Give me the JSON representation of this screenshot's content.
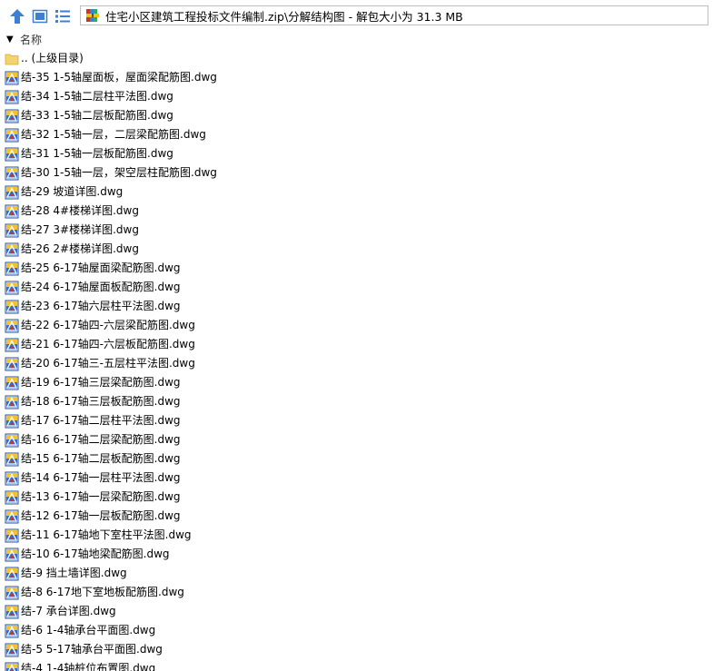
{
  "toolbar": {
    "up_icon": "up-arrow-icon",
    "view_icon": "large-icon-view-icon",
    "list_icon": "list-view-icon"
  },
  "address": {
    "icon": "zip-archive-icon",
    "text": "住宅小区建筑工程投标文件编制.zip\\分解结构图 - 解包大小为 31.3 MB"
  },
  "header": {
    "sort_indicator": "▼",
    "name_column": "名称"
  },
  "items": [
    {
      "icon": "folder-up-icon",
      "label": ".. (上级目录)"
    },
    {
      "icon": "dwg-file-icon",
      "label": "结-35 1-5轴屋面板，屋面梁配筋图.dwg"
    },
    {
      "icon": "dwg-file-icon",
      "label": "结-34 1-5轴二层柱平法图.dwg"
    },
    {
      "icon": "dwg-file-icon",
      "label": "结-33 1-5轴二层板配筋图.dwg"
    },
    {
      "icon": "dwg-file-icon",
      "label": "结-32 1-5轴一层，二层梁配筋图.dwg"
    },
    {
      "icon": "dwg-file-icon",
      "label": "结-31 1-5轴一层板配筋图.dwg"
    },
    {
      "icon": "dwg-file-icon",
      "label": "结-30 1-5轴一层，架空层柱配筋图.dwg"
    },
    {
      "icon": "dwg-file-icon",
      "label": "结-29 坡道详图.dwg"
    },
    {
      "icon": "dwg-file-icon",
      "label": "结-28 4#楼梯详图.dwg"
    },
    {
      "icon": "dwg-file-icon",
      "label": "结-27 3#楼梯详图.dwg"
    },
    {
      "icon": "dwg-file-icon",
      "label": "结-26 2#楼梯详图.dwg"
    },
    {
      "icon": "dwg-file-icon",
      "label": "结-25 6-17轴屋面梁配筋图.dwg"
    },
    {
      "icon": "dwg-file-icon",
      "label": "结-24 6-17轴屋面板配筋图.dwg"
    },
    {
      "icon": "dwg-file-icon",
      "label": "结-23 6-17轴六层柱平法图.dwg"
    },
    {
      "icon": "dwg-file-icon",
      "label": "结-22 6-17轴四-六层梁配筋图.dwg"
    },
    {
      "icon": "dwg-file-icon",
      "label": "结-21 6-17轴四-六层板配筋图.dwg"
    },
    {
      "icon": "dwg-file-icon",
      "label": "结-20 6-17轴三-五层柱平法图.dwg"
    },
    {
      "icon": "dwg-file-icon",
      "label": "结-19 6-17轴三层梁配筋图.dwg"
    },
    {
      "icon": "dwg-file-icon",
      "label": "结-18 6-17轴三层板配筋图.dwg"
    },
    {
      "icon": "dwg-file-icon",
      "label": "结-17 6-17轴二层柱平法图.dwg"
    },
    {
      "icon": "dwg-file-icon",
      "label": "结-16 6-17轴二层梁配筋图.dwg"
    },
    {
      "icon": "dwg-file-icon",
      "label": "结-15 6-17轴二层板配筋图.dwg"
    },
    {
      "icon": "dwg-file-icon",
      "label": "结-14 6-17轴一层柱平法图.dwg"
    },
    {
      "icon": "dwg-file-icon",
      "label": "结-13 6-17轴一层梁配筋图.dwg"
    },
    {
      "icon": "dwg-file-icon",
      "label": "结-12 6-17轴一层板配筋图.dwg"
    },
    {
      "icon": "dwg-file-icon",
      "label": "结-11 6-17轴地下室柱平法图.dwg"
    },
    {
      "icon": "dwg-file-icon",
      "label": "结-10 6-17轴地梁配筋图.dwg"
    },
    {
      "icon": "dwg-file-icon",
      "label": "结-9 挡土墙详图.dwg"
    },
    {
      "icon": "dwg-file-icon",
      "label": "结-8 6-17地下室地板配筋图.dwg"
    },
    {
      "icon": "dwg-file-icon",
      "label": "结-7 承台详图.dwg"
    },
    {
      "icon": "dwg-file-icon",
      "label": "结-6 1-4轴承台平面图.dwg"
    },
    {
      "icon": "dwg-file-icon",
      "label": "结-5 5-17轴承台平面图.dwg"
    },
    {
      "icon": "dwg-file-icon",
      "label": "结-4 1-4轴桩位布置图.dwg"
    }
  ],
  "colors": {
    "toolbar_icon_blue": "#3c7fd6",
    "folder_yellow": "#f3d36b",
    "address_border": "#bfbfbf"
  }
}
